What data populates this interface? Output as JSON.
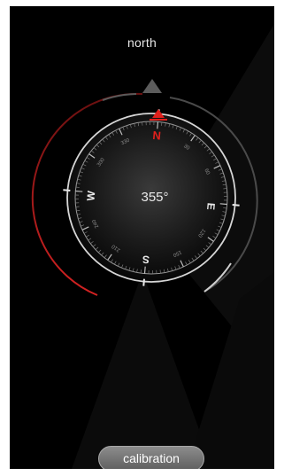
{
  "direction": {
    "label": "north",
    "heading_text": "355°",
    "heading_degrees": 355
  },
  "dial": {
    "cardinals": {
      "north": "N",
      "east": "E",
      "south": "S",
      "west": "W"
    },
    "degree_labels": [
      "30",
      "60",
      "120",
      "150",
      "210",
      "240",
      "300",
      "330"
    ]
  },
  "actions": {
    "calibration_label": "calibration"
  },
  "colors": {
    "background": "#000000",
    "accent_red": "#e0201c",
    "ring_light": "#d8d8d8",
    "indicator_gray": "#6a6a6a"
  }
}
